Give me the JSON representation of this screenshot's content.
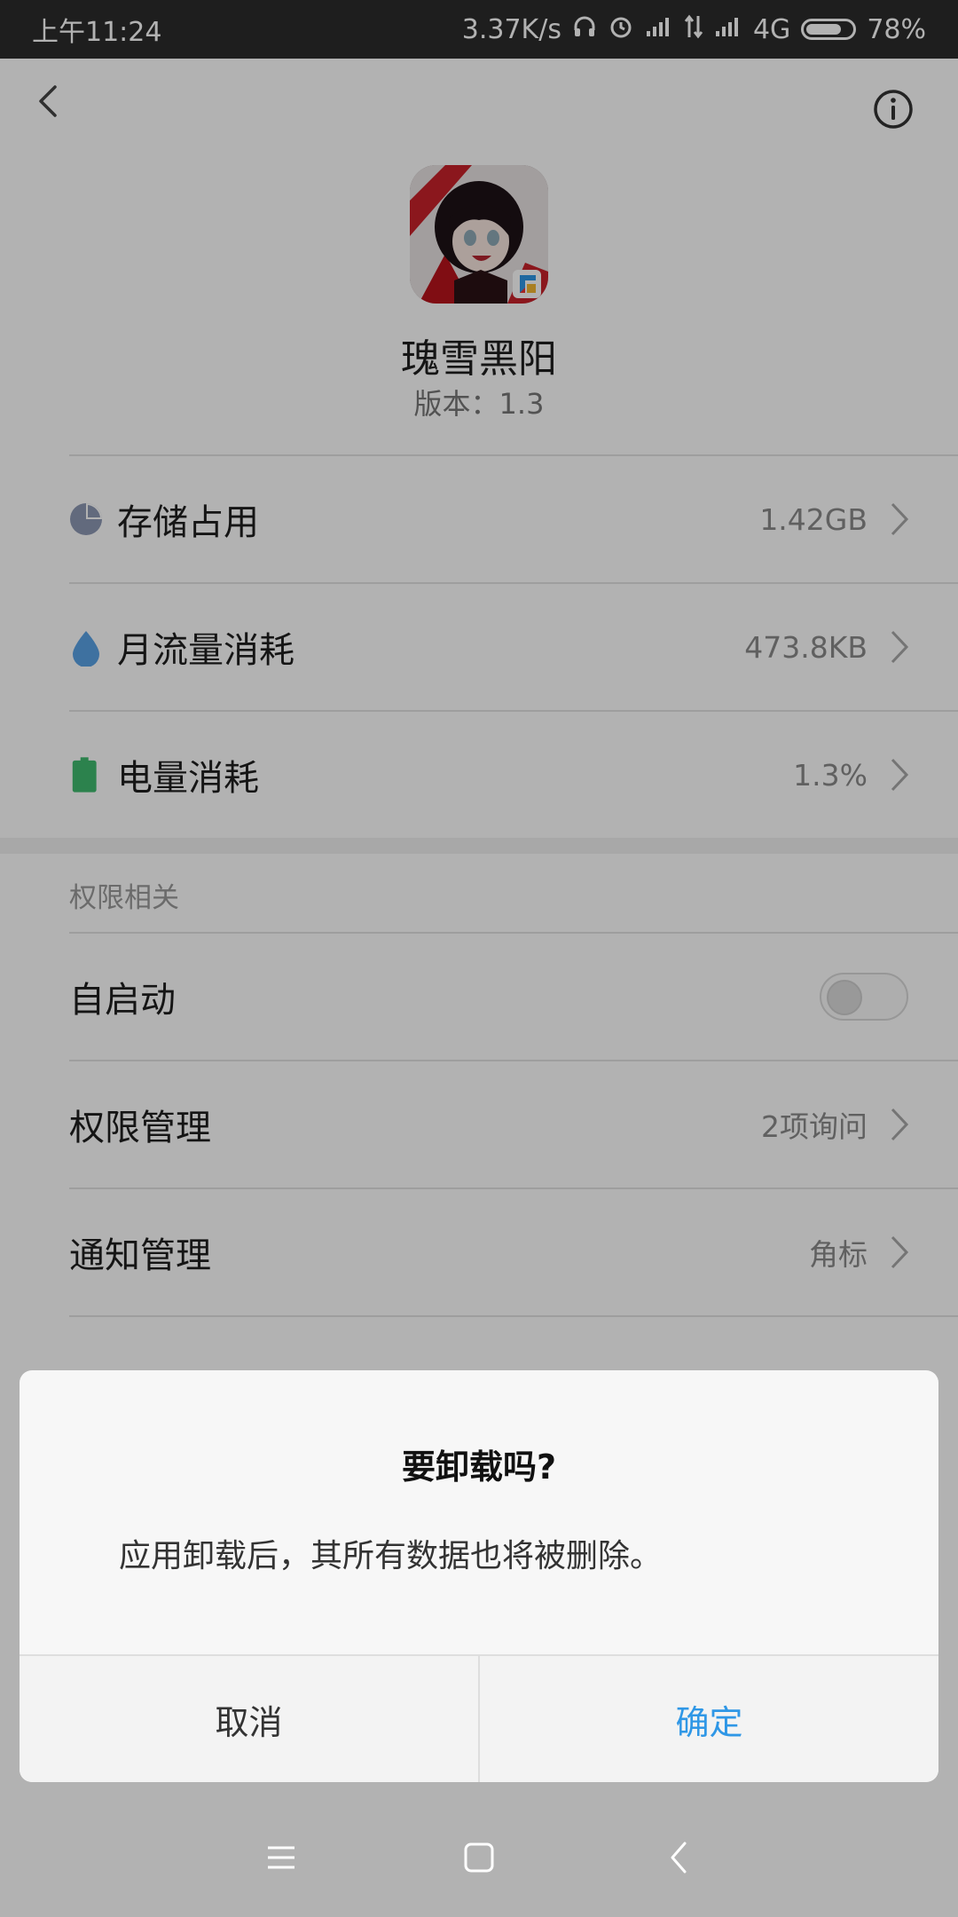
{
  "status_bar": {
    "time": "上午11:24",
    "net_speed": "3.37K/s",
    "network": "4G",
    "battery": "78%",
    "battery_level": 0.78,
    "icons": [
      "headphones-icon",
      "alarm-icon",
      "signal-icon",
      "data-arrows-icon",
      "signal-icon-2",
      "battery-icon"
    ]
  },
  "header": {
    "back_icon": "back-chevron-icon",
    "info_icon": "info-icon"
  },
  "app": {
    "name": "瑰雪黑阳",
    "version": "版本：1.3"
  },
  "usage_rows": [
    {
      "label": "存储占用",
      "value": "1.42GB",
      "icon": "storage-pie-icon",
      "color": "#8d98b3"
    },
    {
      "label": "月流量消耗",
      "value": "473.8KB",
      "icon": "data-drop-icon",
      "color": "#5aa2e6"
    },
    {
      "label": "电量消耗",
      "value": "1.3%",
      "icon": "battery-green-icon",
      "color": "#3fba6f"
    }
  ],
  "permissions": {
    "section_title": "权限相关",
    "autostart": {
      "label": "自启动",
      "enabled": false
    },
    "rows": [
      {
        "label": "权限管理",
        "value": "2项询问"
      },
      {
        "label": "通知管理",
        "value": "角标"
      }
    ]
  },
  "dialog": {
    "title": "要卸载吗?",
    "message": "应用卸载后，其所有数据也将被删除。",
    "cancel": "取消",
    "confirm": "确定",
    "confirm_color": "#2f97e6"
  },
  "nav_bar": {
    "icons": [
      "menu-icon",
      "home-icon",
      "back-icon"
    ]
  }
}
